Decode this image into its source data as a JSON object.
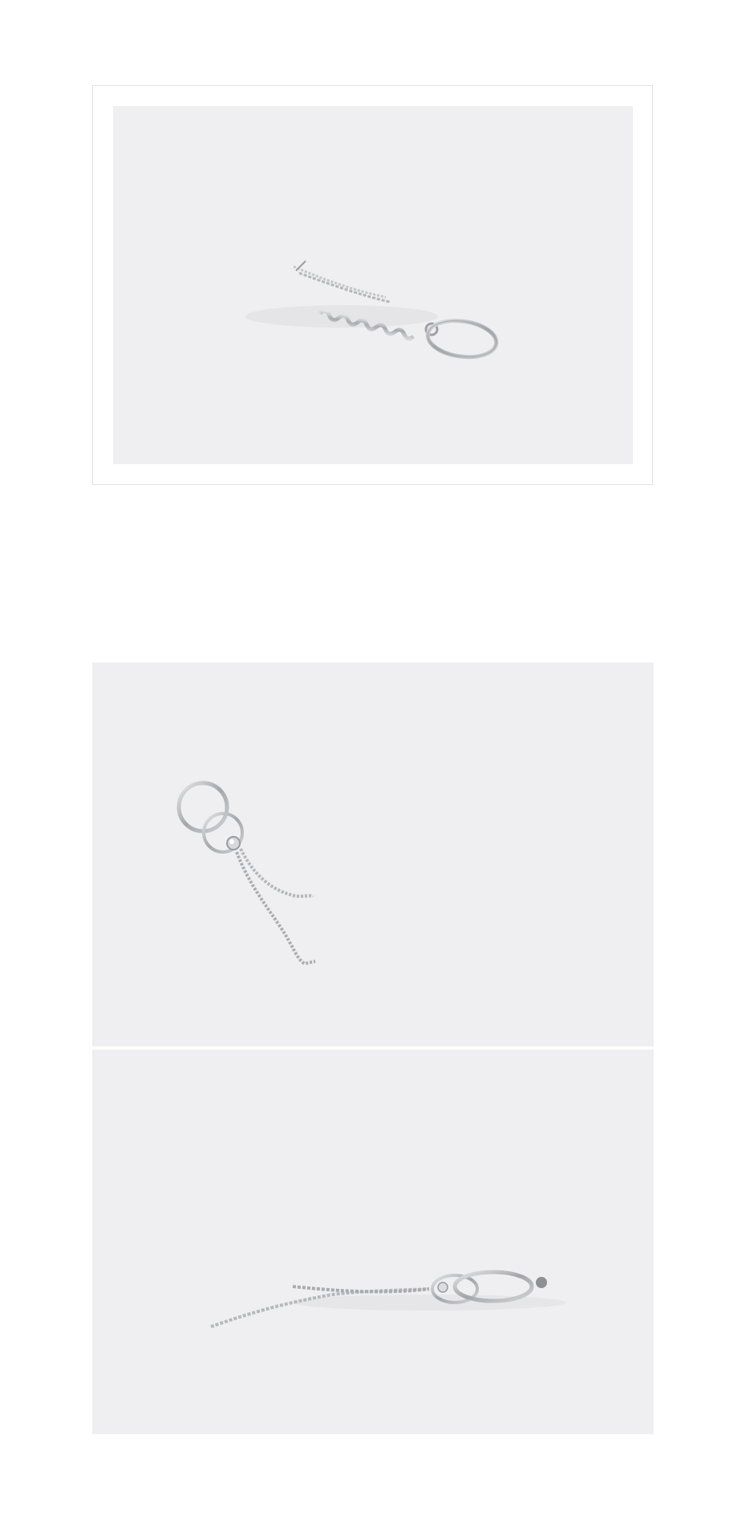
{
  "page": {
    "background": "#ffffff"
  },
  "photos": [
    {
      "subject": "earring-chain-and-hoop-lying-flat",
      "background": "#efeff1"
    },
    {
      "subject": "earring-double-hoop-with-two-chains",
      "background": "#efeff1"
    },
    {
      "subject": "earring-hoop-with-long-chains-side-view",
      "background": "#efeff1"
    }
  ],
  "colors": {
    "frame_border": "#e1e1e3",
    "photo_background": "#efeff1",
    "metal": "#b9bbbf",
    "metal_dark": "#8e9095"
  }
}
